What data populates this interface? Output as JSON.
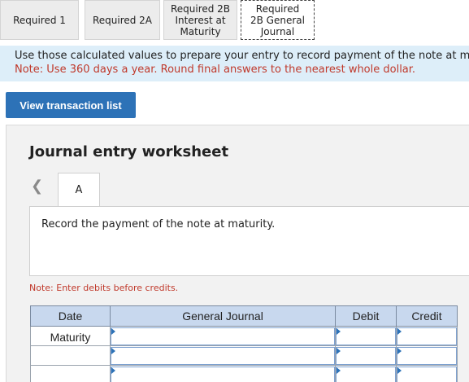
{
  "tabs": [
    {
      "label": "Required 1",
      "active": false
    },
    {
      "label": "Required 2A",
      "active": false
    },
    {
      "label": "Required 2B Interest at Maturity",
      "active": false
    },
    {
      "label": "Required 2B General Journal",
      "active": true
    }
  ],
  "instructions": {
    "main": "Use those calculated values to prepare your entry to record payment of the note at m",
    "note": "Note: Use 360 days a year. Round final answers to the nearest whole dollar."
  },
  "view_button": "View transaction list",
  "worksheet": {
    "title": "Journal entry worksheet",
    "entry_tab": "A",
    "record_text": "Record the payment of the note at maturity.",
    "debit_note": "Note: Enter debits before credits."
  },
  "table": {
    "headers": {
      "date": "Date",
      "journal": "General Journal",
      "debit": "Debit",
      "credit": "Credit"
    },
    "rows": [
      {
        "date": "Maturity"
      },
      {
        "date": ""
      },
      {
        "date": ""
      }
    ]
  }
}
